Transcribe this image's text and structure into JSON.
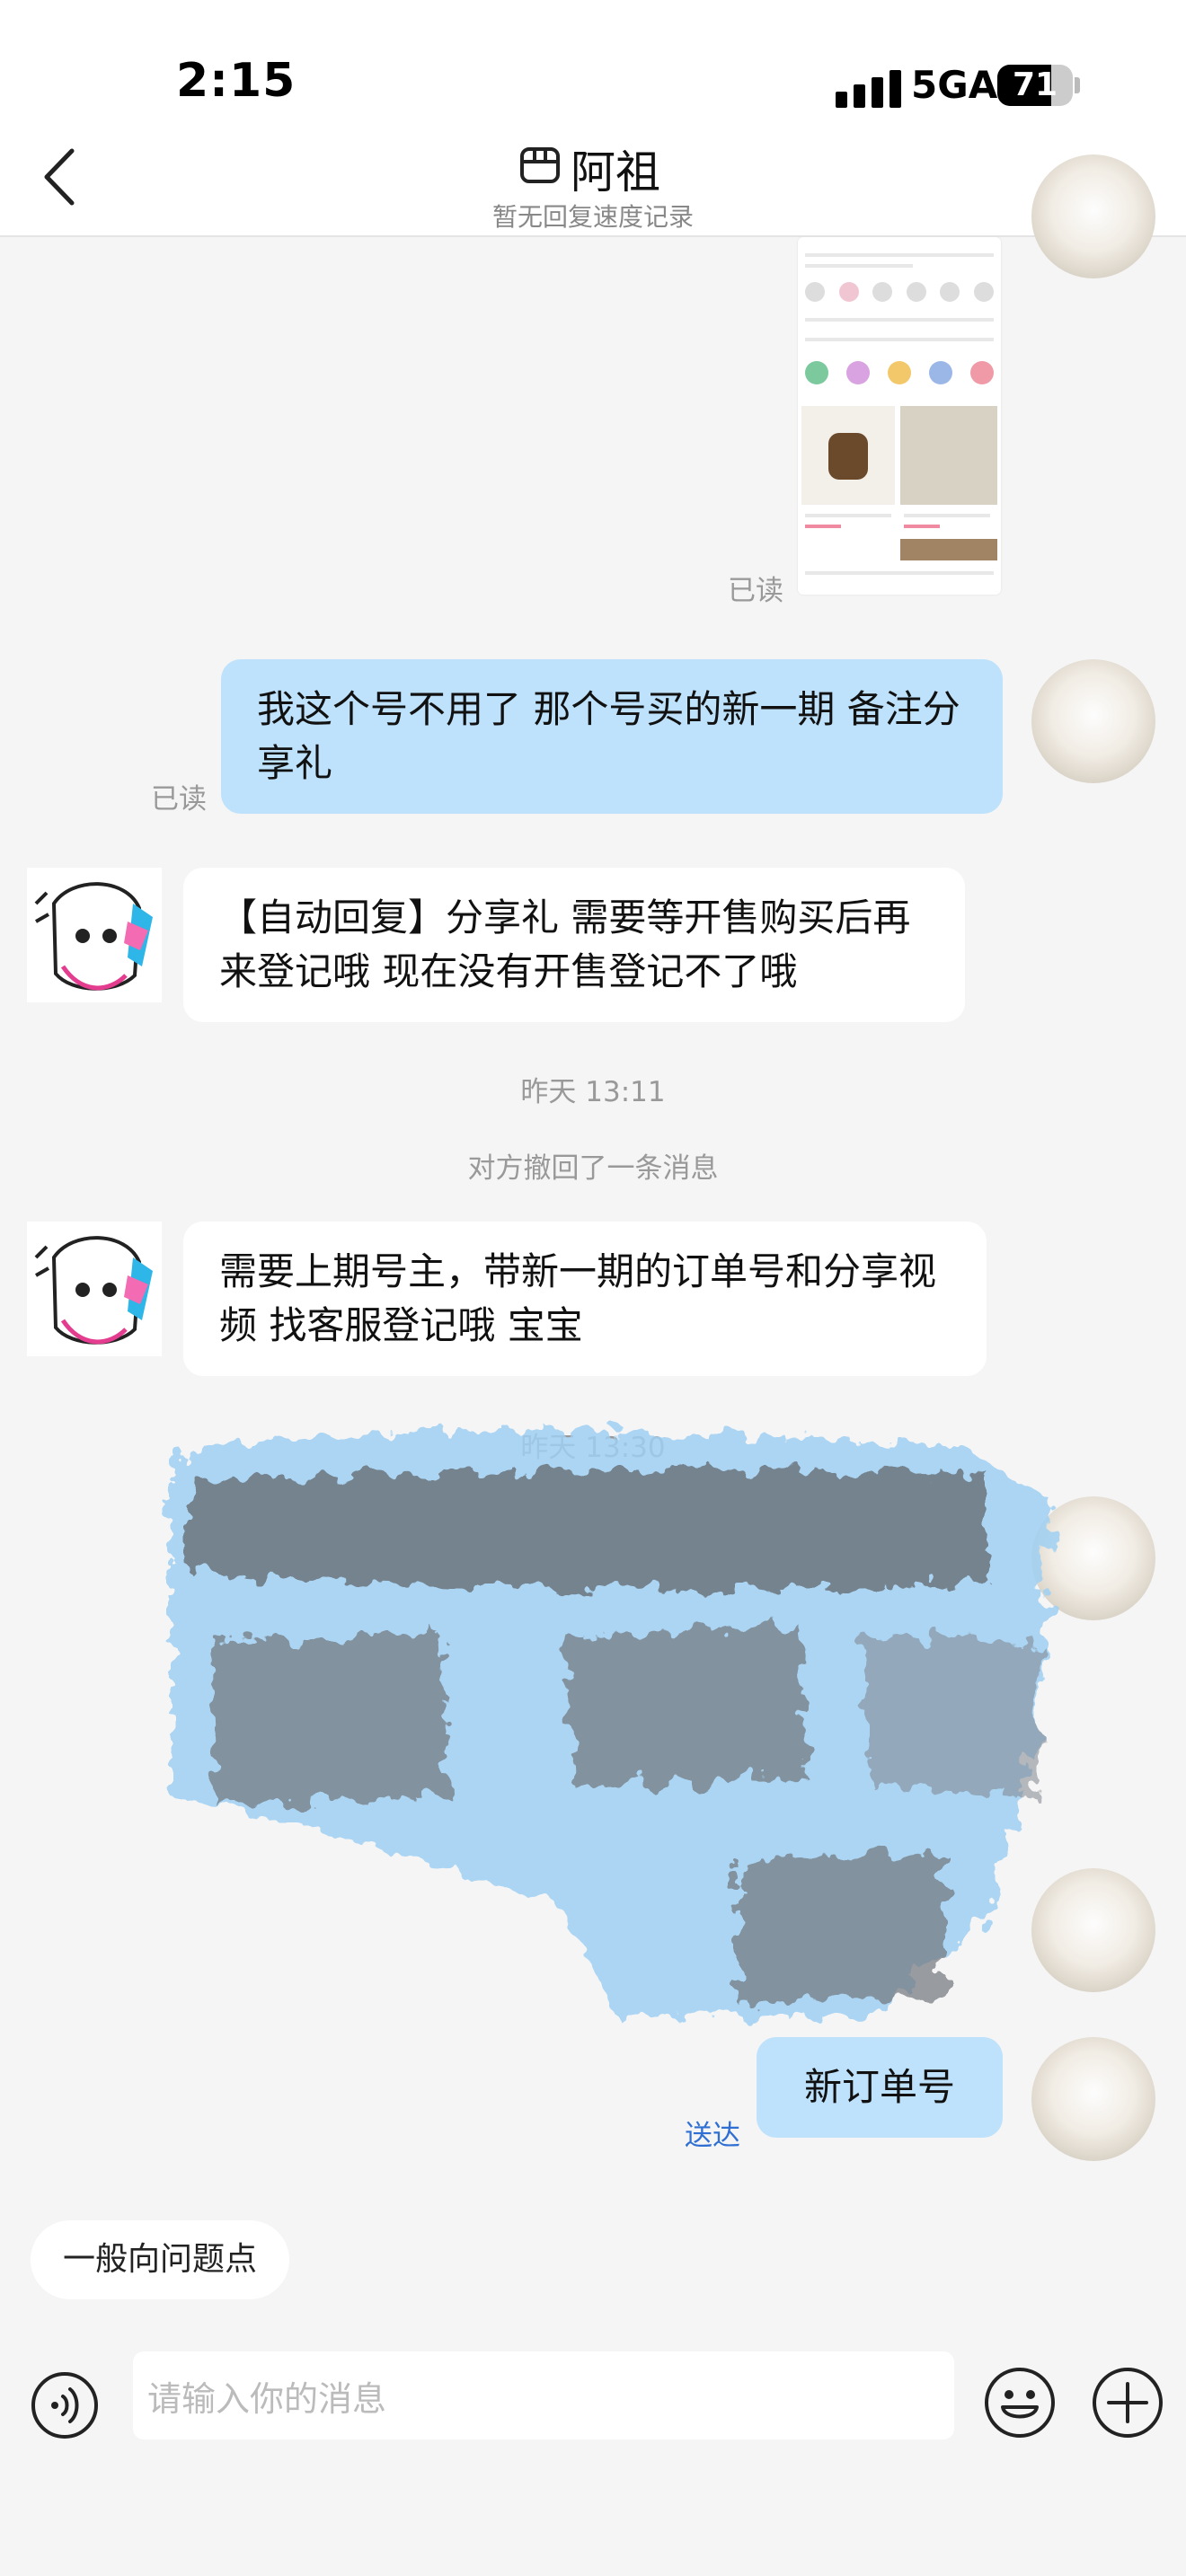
{
  "status_bar": {
    "time": "2:15",
    "network": "5GA",
    "battery": "71",
    "battery_level": 71
  },
  "nav": {
    "title": "阿祖",
    "subtitle": "暂无回复速度记录"
  },
  "messages": {
    "read_1": "已读",
    "read_2": "已读",
    "me_1": "我这个号不用了 那个号买的新一期 备注分享礼",
    "them_1": "【自动回复】分享礼 需要等开售购买后再来登记哦 现在没有开售登记不了哦",
    "timestamp_1": "昨天 13:11",
    "recall_notice": "对方撤回了一条消息",
    "them_2": "需要上期号主，带新一期的订单号和分享视频 找客服登记哦 宝宝",
    "timestamp_2": "昨天 13:30",
    "me_2": "新订单号",
    "delivered": "送达"
  },
  "quick_question": "一般向问题点",
  "input": {
    "placeholder": "请输入你的消息"
  },
  "icons": {
    "back": "chevron-left-icon",
    "more": "more-dots-icon",
    "voice": "voice-icon",
    "emoji": "emoji-icon",
    "plus": "plus-icon"
  },
  "colors": {
    "my_bubble": "#bee2fb",
    "their_bubble": "#ffffff",
    "delivered_text": "#2f6fd3"
  }
}
